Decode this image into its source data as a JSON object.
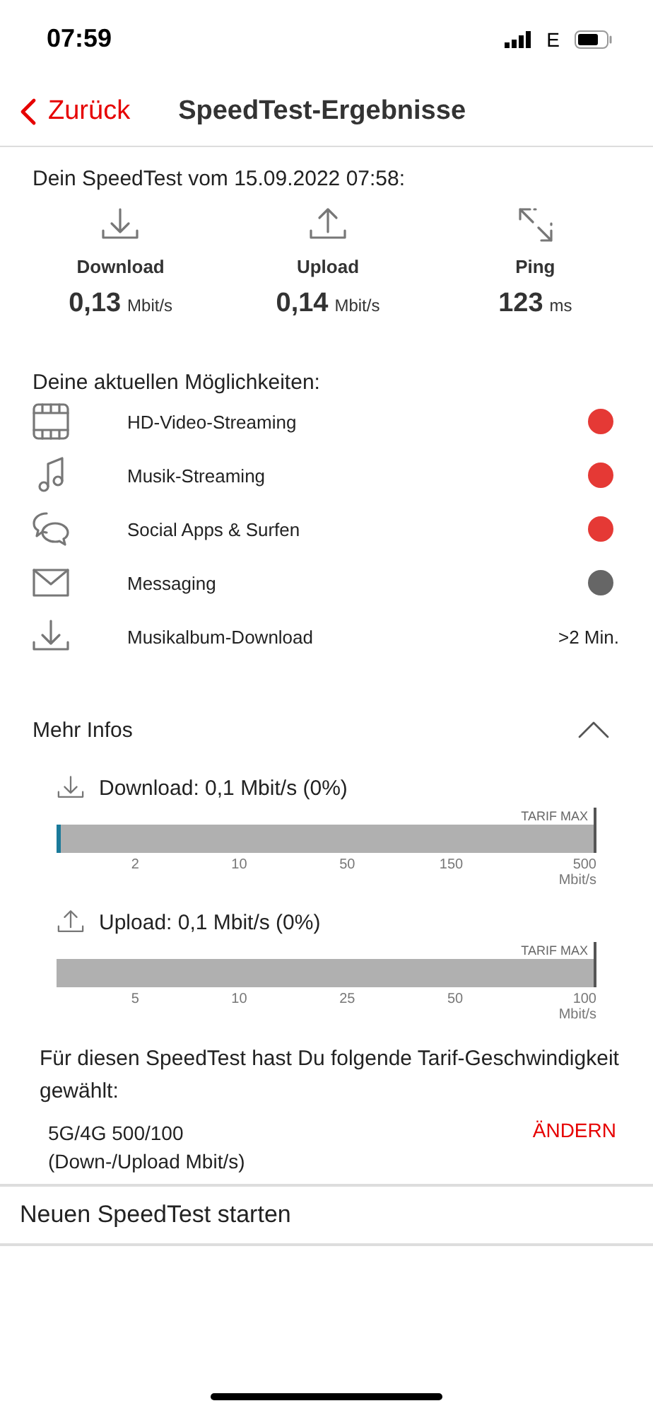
{
  "status_bar": {
    "time": "07:59",
    "network": "E"
  },
  "nav": {
    "back": "Zurück",
    "title": "SpeedTest-Ergebnisse"
  },
  "summary": {
    "heading": "Dein SpeedTest vom 15.09.2022 07:58:",
    "metrics": [
      {
        "kind": "download",
        "label": "Download",
        "value": "0,13",
        "unit": "Mbit/s"
      },
      {
        "kind": "upload",
        "label": "Upload",
        "value": "0,14",
        "unit": "Mbit/s"
      },
      {
        "kind": "ping",
        "label": "Ping",
        "value": "123",
        "unit": "ms"
      }
    ]
  },
  "possibilities": {
    "heading": "Deine aktuellen Möglichkeiten:",
    "items": [
      {
        "kind": "film",
        "label": "HD-Video-Streaming",
        "color": "#e53935"
      },
      {
        "kind": "music",
        "label": "Musik-Streaming",
        "color": "#e53935"
      },
      {
        "kind": "chat",
        "label": "Social Apps & Surfen",
        "color": "#e53935"
      },
      {
        "kind": "mail",
        "label": "Messaging",
        "color": "#666666"
      },
      {
        "kind": "download",
        "label": "Musikalbum-Download",
        "value": ">2 Min."
      }
    ]
  },
  "more_info": {
    "title": "Mehr Infos",
    "expanded": true,
    "meters": [
      {
        "kind": "download",
        "label": "Download: 0,1 Mbit/s (0%)",
        "max_label": "TARIF MAX",
        "level": 0.006,
        "ticks": [
          "2",
          "10",
          "50",
          "150",
          "500"
        ],
        "unit": "Mbit/s"
      },
      {
        "kind": "upload",
        "label": "Upload: 0,1 Mbit/s (0%)",
        "max_label": "TARIF MAX",
        "ticks": [
          "5",
          "10",
          "25",
          "50",
          "100"
        ],
        "unit": "Mbit/s"
      }
    ],
    "tariff_text": "Für diesen SpeedTest hast Du folgende Tarif-Geschwindigkeit gewählt:",
    "tariff_name": "5G/4G 500/100",
    "tariff_detail": "(Down-/Upload Mbit/s)",
    "change": "ÄNDERN"
  },
  "actions": [
    {
      "label": "Neuen SpeedTest starten"
    }
  ]
}
